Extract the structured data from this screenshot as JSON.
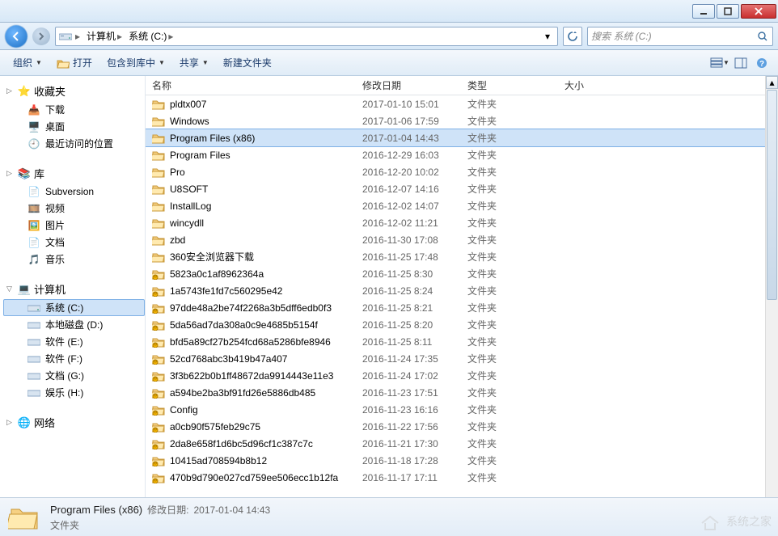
{
  "window": {
    "minimize": "—",
    "maximize": "☐",
    "close": "✕"
  },
  "breadcrumb": {
    "computer": "计算机",
    "drive": "系统 (C:)"
  },
  "search": {
    "placeholder": "搜索 系统 (C:)"
  },
  "toolbar": {
    "organize": "组织",
    "open": "打开",
    "include": "包含到库中",
    "share": "共享",
    "newfolder": "新建文件夹"
  },
  "nav": {
    "favorites": "收藏夹",
    "downloads": "下载",
    "desktop": "桌面",
    "recent": "最近访问的位置",
    "libraries": "库",
    "subversion": "Subversion",
    "videos": "视频",
    "pictures": "图片",
    "documents": "文档",
    "music": "音乐",
    "computer": "计算机",
    "system_c": "系统 (C:)",
    "local_d": "本地磁盘 (D:)",
    "soft_e": "软件 (E:)",
    "soft_f": "软件 (F:)",
    "doc_g": "文档 (G:)",
    "ent_h": "娱乐 (H:)",
    "network": "网络"
  },
  "columns": {
    "name": "名称",
    "date": "修改日期",
    "type": "类型",
    "size": "大小"
  },
  "typevals": {
    "folder": "文件夹"
  },
  "files": [
    {
      "name": "pldtx007",
      "date": "2017-01-10 15:01",
      "locked": false
    },
    {
      "name": "Windows",
      "date": "2017-01-06 17:59",
      "locked": false
    },
    {
      "name": "Program Files (x86)",
      "date": "2017-01-04 14:43",
      "locked": false,
      "selected": true
    },
    {
      "name": "Program Files",
      "date": "2016-12-29 16:03",
      "locked": false
    },
    {
      "name": "Pro",
      "date": "2016-12-20 10:02",
      "locked": false
    },
    {
      "name": "U8SOFT",
      "date": "2016-12-07 14:16",
      "locked": false
    },
    {
      "name": "InstallLog",
      "date": "2016-12-02 14:07",
      "locked": false
    },
    {
      "name": "wincydll",
      "date": "2016-12-02 11:21",
      "locked": false
    },
    {
      "name": "zbd",
      "date": "2016-11-30 17:08",
      "locked": false
    },
    {
      "name": "360安全浏览器下载",
      "date": "2016-11-25 17:48",
      "locked": false
    },
    {
      "name": "5823a0c1af8962364a",
      "date": "2016-11-25 8:30",
      "locked": true
    },
    {
      "name": "1a5743fe1fd7c560295e42",
      "date": "2016-11-25 8:24",
      "locked": true
    },
    {
      "name": "97dde48a2be74f2268a3b5dff6edb0f3",
      "date": "2016-11-25 8:21",
      "locked": true
    },
    {
      "name": "5da56ad7da308a0c9e4685b5154f",
      "date": "2016-11-25 8:20",
      "locked": true
    },
    {
      "name": "bfd5a89cf27b254fcd68a5286bfe8946",
      "date": "2016-11-25 8:11",
      "locked": true
    },
    {
      "name": "52cd768abc3b419b47a407",
      "date": "2016-11-24 17:35",
      "locked": true
    },
    {
      "name": "3f3b622b0b1ff48672da9914443e11e3",
      "date": "2016-11-24 17:02",
      "locked": true
    },
    {
      "name": "a594be2ba3bf91fd26e5886db485",
      "date": "2016-11-23 17:51",
      "locked": true
    },
    {
      "name": "Config",
      "date": "2016-11-23 16:16",
      "locked": true
    },
    {
      "name": "a0cb90f575feb29c75",
      "date": "2016-11-22 17:56",
      "locked": true
    },
    {
      "name": "2da8e658f1d6bc5d96cf1c387c7c",
      "date": "2016-11-21 17:30",
      "locked": true
    },
    {
      "name": "10415ad708594b8b12",
      "date": "2016-11-18 17:28",
      "locked": true
    },
    {
      "name": "470b9d790e027cd759ee506ecc1b12fa",
      "date": "2016-11-17 17:11",
      "locked": true
    }
  ],
  "status": {
    "name": "Program Files (x86)",
    "date_label": "修改日期:",
    "date": "2017-01-04 14:43",
    "type": "文件夹"
  },
  "watermark": "系统之家"
}
